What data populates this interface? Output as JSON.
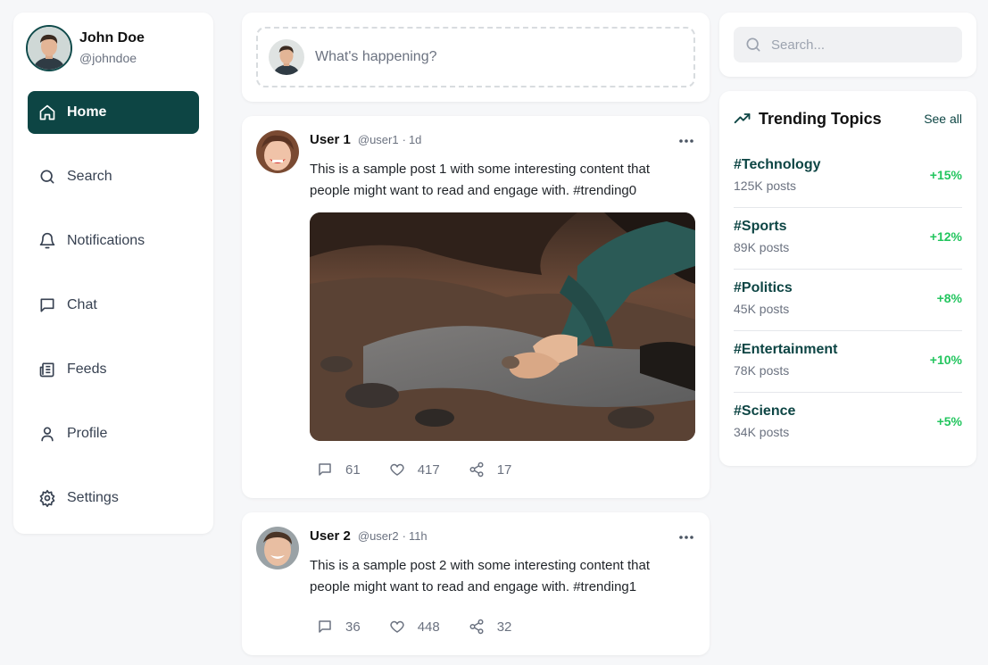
{
  "user": {
    "name": "John Doe",
    "handle": "@johndoe"
  },
  "nav": {
    "items": [
      {
        "label": "Home",
        "icon": "home-icon",
        "active": true
      },
      {
        "label": "Search",
        "icon": "search-icon"
      },
      {
        "label": "Notifications",
        "icon": "bell-icon"
      },
      {
        "label": "Chat",
        "icon": "chat-icon"
      },
      {
        "label": "Feeds",
        "icon": "newspaper-icon"
      },
      {
        "label": "Profile",
        "icon": "user-icon"
      },
      {
        "label": "Settings",
        "icon": "gear-icon"
      }
    ]
  },
  "composer": {
    "placeholder": "What's happening?"
  },
  "posts": [
    {
      "user": "User 1",
      "handle": "@user1",
      "dot": "·",
      "time": "1d",
      "text": "This is a sample post 1 with some interesting content that people might want to read and engage with. #trending0",
      "has_image": true,
      "comments": "61",
      "likes": "417",
      "shares": "17"
    },
    {
      "user": "User 2",
      "handle": "@user2",
      "dot": "·",
      "time": "11h",
      "text": "This is a sample post 2 with some interesting content that people might want to read and engage with. #trending1",
      "has_image": false,
      "comments": "36",
      "likes": "448",
      "shares": "32"
    }
  ],
  "search": {
    "placeholder": "Search..."
  },
  "trending": {
    "title": "Trending Topics",
    "see_all": "See all",
    "items": [
      {
        "tag": "#Technology",
        "count": "125K posts",
        "change": "+15%"
      },
      {
        "tag": "#Sports",
        "count": "89K posts",
        "change": "+12%"
      },
      {
        "tag": "#Politics",
        "count": "45K posts",
        "change": "+8%"
      },
      {
        "tag": "#Entertainment",
        "count": "78K posts",
        "change": "+10%"
      },
      {
        "tag": "#Science",
        "count": "34K posts",
        "change": "+5%"
      }
    ]
  },
  "colors": {
    "accent": "#0d4544",
    "positive": "#22c55e",
    "muted": "#6b7280",
    "background": "#f6f7f9"
  }
}
